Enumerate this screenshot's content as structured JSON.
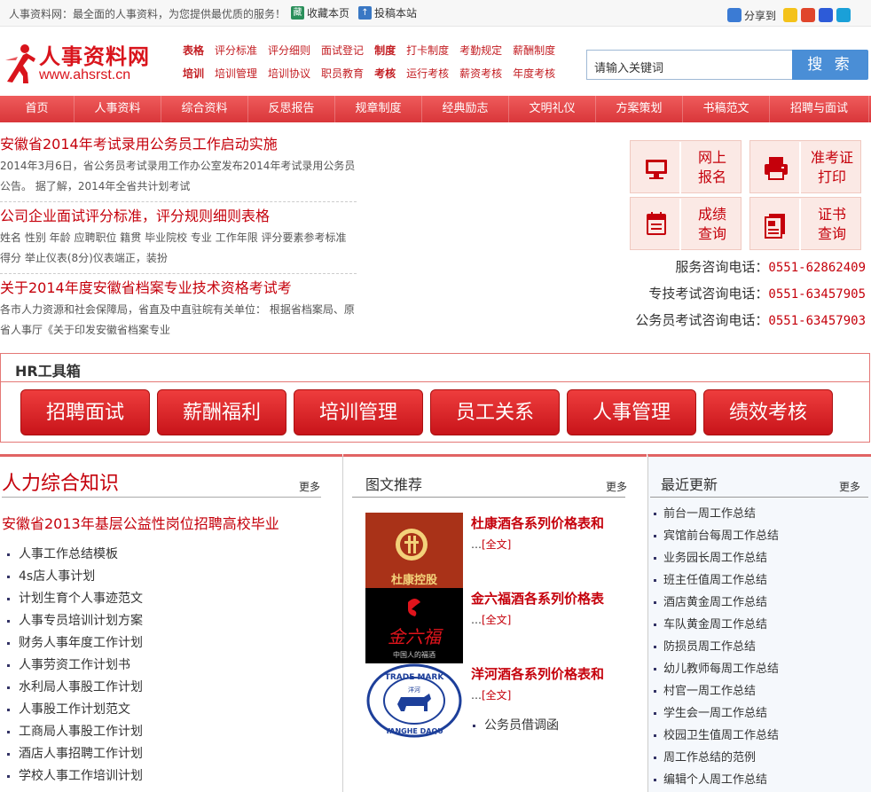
{
  "topbar": {
    "welcome": "人事资料网：最全面的人事资料，为您提供最优质的服务！",
    "favorite": "收藏本页",
    "submit": "投稿本站",
    "share": "分享到"
  },
  "logo": {
    "name": "人事资料网",
    "domain": "www.ahsrst.cn"
  },
  "header_links": {
    "row1": [
      "表格",
      "评分标准",
      "评分细则",
      "面试登记",
      "制度",
      "打卡制度",
      "考勤规定",
      "薪酬制度"
    ],
    "row2": [
      "培训",
      "培训管理",
      "培训协议",
      "职员教育",
      "考核",
      "运行考核",
      "薪资考核",
      "年度考核"
    ]
  },
  "search": {
    "placeholder": "请输入关键词",
    "button": "搜 索"
  },
  "nav": [
    "首页",
    "人事资料",
    "综合资料",
    "反思报告",
    "规章制度",
    "经典励志",
    "文明礼仪",
    "方案策划",
    "书稿范文",
    "招聘与面试"
  ],
  "news": [
    {
      "title": "安徽省2014年考试录用公务员工作启动实施",
      "desc": "2014年3月6日，省公务员考试录用工作办公室发布2014年考试录用公务员公告。 据了解，2014年全省共计划考试"
    },
    {
      "title": "公司企业面试评分标准，评分规则细则表格",
      "desc": "姓名 性别 年龄 应聘职位 籍贯 毕业院校 专业 工作年限 评分要素参考标准得分 举止仪表(8分)仪表端正，装扮"
    },
    {
      "title": "关于2014年度安徽省档案专业技术资格考试考",
      "desc": "各市人力资源和社会保障局，省直及中直驻皖有关单位： 根据省档案局、原省人事厅《关于印发安徽省档案专业"
    }
  ],
  "services": [
    {
      "label1": "网上",
      "label2": "报名",
      "icon": "computer-icon"
    },
    {
      "label1": "准考证",
      "label2": "打印",
      "icon": "printer-icon"
    },
    {
      "label1": "成绩",
      "label2": "查询",
      "icon": "calendar-icon"
    },
    {
      "label1": "证书",
      "label2": "查询",
      "icon": "certificate-icon"
    }
  ],
  "phones": [
    {
      "label": "服务咨询电话：",
      "number": "0551-62862409"
    },
    {
      "label": "专技考试咨询电话：",
      "number": "0551-63457905"
    },
    {
      "label": "公务员考试咨询电话：",
      "number": "0551-63457903"
    }
  ],
  "hr_tools": {
    "title": "HR工具箱",
    "buttons": [
      "招聘面试",
      "薪酬福利",
      "培训管理",
      "员工关系",
      "人事管理",
      "绩效考核"
    ]
  },
  "knowledge": {
    "title": "人力综合知识",
    "more": "更多",
    "headline": "安徽省2013年基层公益性岗位招聘高校毕业",
    "items": [
      "人事工作总结模板",
      "4s店人事计划",
      "计划生育个人事迹范文",
      "人事专员培训计划方案",
      "财务人事年度工作计划",
      "人事劳资工作计划书",
      "水利局人事股工作计划",
      "人事股工作计划范文",
      "工商局人事股工作计划",
      "酒店人事招聘工作计划",
      "学校人事工作培训计划"
    ]
  },
  "picture_news": {
    "title": "图文推荐",
    "more": "更多",
    "items": [
      {
        "title": "杜康酒各系列价格表和",
        "ellipsis": "…",
        "link": "[全文]",
        "logo": "杜康控股"
      },
      {
        "title": "金六福酒各系列价格表",
        "ellipsis": "…",
        "link": "[全文]",
        "logo": "金六福",
        "slogan": "中国人的福酒"
      },
      {
        "title": "洋河酒各系列价格表和",
        "ellipsis": "…",
        "link": "[全文]",
        "logo_top": "TRADE MARK",
        "logo_bottom": "YANGHE DAQU",
        "logo_mid": "洋河"
      }
    ],
    "extra": "公务员借调函"
  },
  "recent": {
    "title": "最近更新",
    "more": "更多",
    "items": [
      "前台一周工作总结",
      "宾馆前台每周工作总结",
      "业务园长周工作总结",
      "班主任值周工作总结",
      "酒店黄金周工作总结",
      "车队黄金周工作总结",
      "防损员周工作总结",
      "幼儿教师每周工作总结",
      "村官一周工作总结",
      "学生会一周工作总结",
      "校园卫生值周工作总结",
      "周工作总结的范例",
      "编辑个人周工作总结"
    ]
  },
  "colors": {
    "brand_red": "#c5000b",
    "nav_red": "#e04444",
    "search_blue": "#4a8ed6"
  }
}
